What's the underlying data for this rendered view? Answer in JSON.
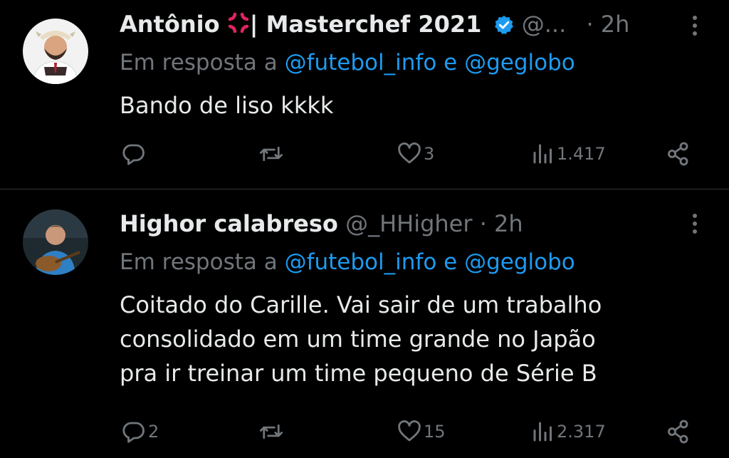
{
  "tweets": [
    {
      "display_name": "Antônio",
      "display_name_suffix": "| Masterchef 2021",
      "handle": "@...",
      "time": "· 2h",
      "reply_prefix": "Em resposta a",
      "mention1": "@futebol_info",
      "reply_and": "e",
      "mention2": "@geglobo",
      "text": "Bando de liso kkkk",
      "replies": "",
      "retweets": "",
      "likes": "3",
      "views": "1.417"
    },
    {
      "display_name": "Highor calabreso",
      "handle": "@_HHigher",
      "time": "· 2h",
      "reply_prefix": "Em resposta a",
      "mention1": "@futebol_info",
      "reply_and": "e",
      "mention2": "@geglobo",
      "text": "Coitado do Carille. Vai sair de um trabalho\nconsolidado em um time grande no Japão\npra ir treinar um time pequeno de Série B",
      "replies": "2",
      "retweets": "",
      "likes": "15",
      "views": "2.317"
    }
  ],
  "icons": [
    "anger-emoji-icon",
    "verified-badge-icon",
    "more-icon",
    "reply-icon",
    "retweet-icon",
    "like-icon",
    "views-icon",
    "share-icon"
  ],
  "colors": {
    "background": "#000000",
    "text": "#e7e9ea",
    "muted": "#71767b",
    "link": "#1d9bf0",
    "divider": "#2f3336"
  }
}
